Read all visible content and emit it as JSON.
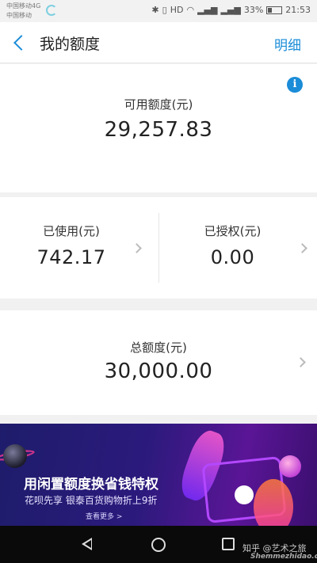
{
  "status_bar": {
    "carrier_line1": "中国移动4G",
    "carrier_line2": "中国移动",
    "battery_percent": "33%",
    "battery_level": 0.33,
    "time": "21:53",
    "icons": [
      "bluetooth-icon",
      "vibrate-icon",
      "hd-icon",
      "wifi-icon",
      "signal-icon",
      "signal-icon",
      "battery-icon"
    ]
  },
  "nav": {
    "title": "我的额度",
    "detail_link": "明细"
  },
  "available": {
    "label": "可用额度(元)",
    "value": "29,257.83"
  },
  "used": {
    "label": "已使用(元)",
    "value": "742.17"
  },
  "authorized": {
    "label": "已授权(元)",
    "value": "0.00"
  },
  "total": {
    "label": "总额度(元)",
    "value": "30,000.00"
  },
  "banner": {
    "title": "用闲置额度换省钱特权",
    "subtitle": "花呗先享  银泰百货购物折上9折",
    "more": "查看更多 >"
  },
  "watermark": {
    "text": "知乎 @艺术之旅",
    "site": "Shemmezhidao.com"
  },
  "colors": {
    "accent": "#1a8cd8"
  }
}
